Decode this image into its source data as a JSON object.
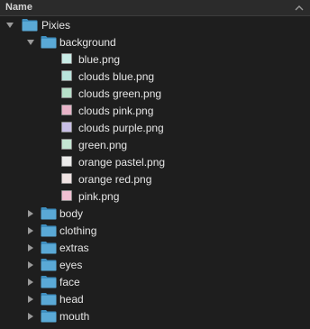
{
  "header": {
    "column_label": "Name"
  },
  "tree": {
    "root": {
      "label": "Pixies",
      "expanded": true
    },
    "background": {
      "label": "background",
      "expanded": true
    },
    "files": [
      {
        "label": "blue.png",
        "swatch": "#c9ece6"
      },
      {
        "label": "clouds blue.png",
        "swatch": "#b9e4dc"
      },
      {
        "label": "clouds green.png",
        "swatch": "#b7e0c9"
      },
      {
        "label": "clouds pink.png",
        "swatch": "#e7b3c8"
      },
      {
        "label": "clouds purple.png",
        "swatch": "#c9bfe6"
      },
      {
        "label": "green.png",
        "swatch": "#c4e6d3"
      },
      {
        "label": "orange pastel.png",
        "swatch": "#ecebea"
      },
      {
        "label": "orange red.png",
        "swatch": "#f0e3e3"
      },
      {
        "label": "pink.png",
        "swatch": "#f0c0d2"
      }
    ],
    "folders": [
      {
        "label": "body"
      },
      {
        "label": "clothing"
      },
      {
        "label": "extras"
      },
      {
        "label": "eyes"
      },
      {
        "label": "face"
      },
      {
        "label": "head"
      },
      {
        "label": "mouth"
      }
    ]
  },
  "colors": {
    "folder": "#5aa9d6",
    "folder_dark": "#3f8fc0",
    "disclosure": "#9a9a9a"
  }
}
